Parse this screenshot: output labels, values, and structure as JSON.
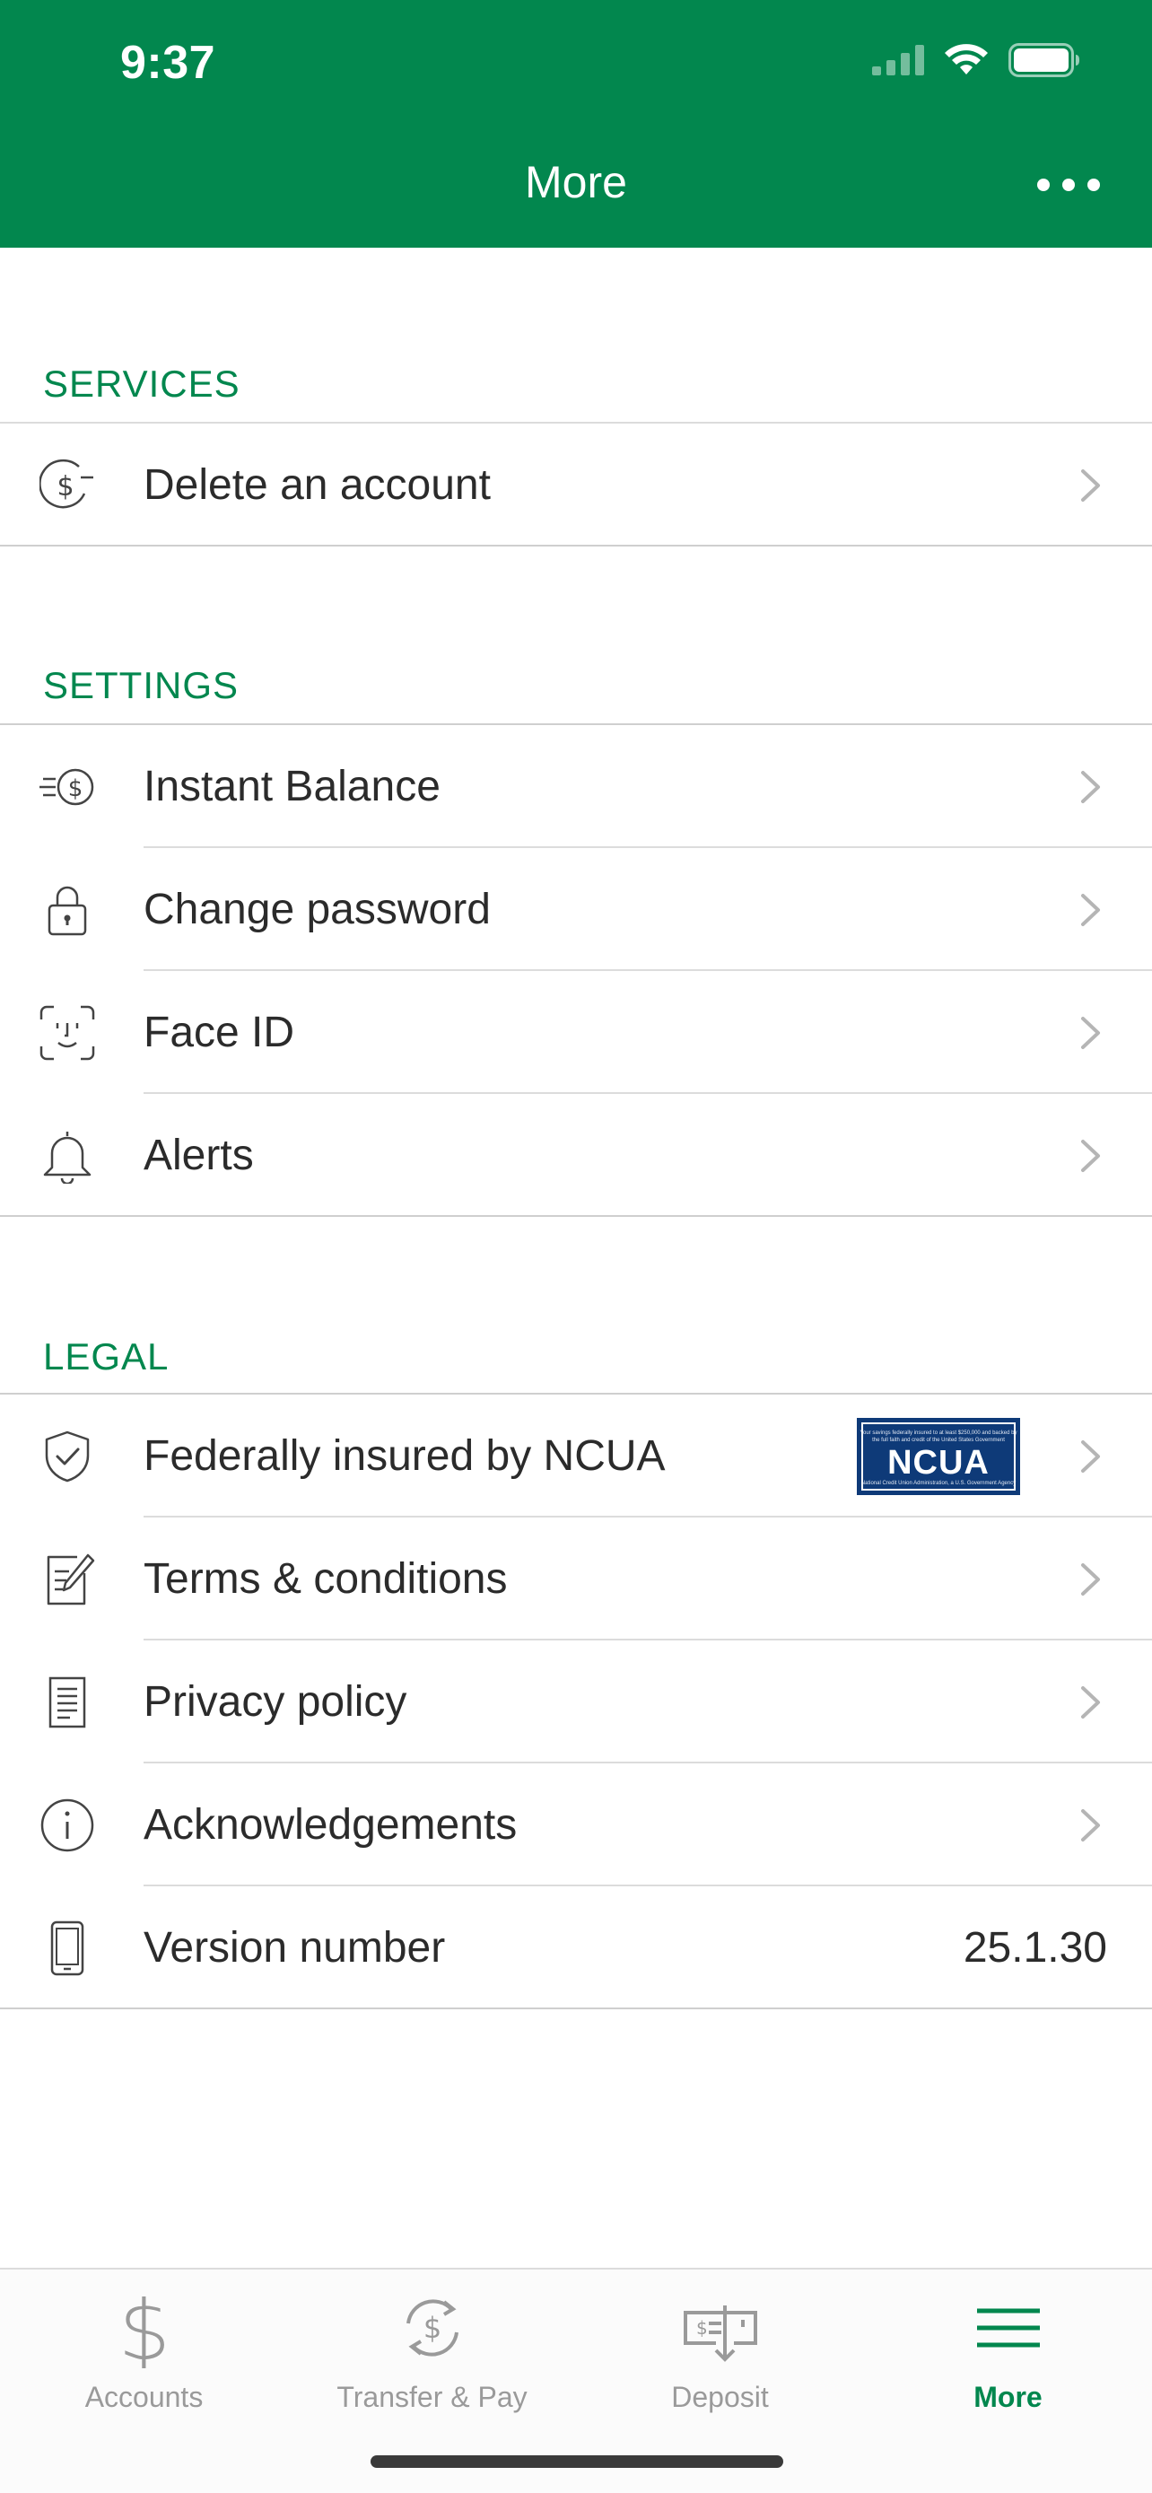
{
  "status_bar": {
    "time": "9:37"
  },
  "header": {
    "title": "More"
  },
  "sections": {
    "services": {
      "title": "SERVICES",
      "items": [
        {
          "label": "Delete an account",
          "icon": "dollar-minus-icon"
        }
      ]
    },
    "settings": {
      "title": "SETTINGS",
      "items": [
        {
          "label": "Instant Balance",
          "icon": "instant-balance-icon"
        },
        {
          "label": "Change password",
          "icon": "lock-icon"
        },
        {
          "label": "Face ID",
          "icon": "face-id-icon"
        },
        {
          "label": "Alerts",
          "icon": "bell-icon"
        }
      ]
    },
    "legal": {
      "title": "LEGAL",
      "items": [
        {
          "label": "Federally insured by NCUA",
          "icon": "shield-check-icon",
          "badge": "NCUA",
          "badge_fine_top": "Your savings federally insured to at least $250,000 and backed by the full faith and credit of the United States Government",
          "badge_fine_bottom": "National Credit Union Administration, a U.S. Government Agency"
        },
        {
          "label": "Terms & conditions",
          "icon": "document-pen-icon"
        },
        {
          "label": "Privacy policy",
          "icon": "document-icon"
        },
        {
          "label": "Acknowledgements",
          "icon": "info-icon"
        },
        {
          "label": "Version number",
          "icon": "phone-icon",
          "value": "25.1.30"
        }
      ]
    }
  },
  "tabbar": {
    "items": [
      {
        "label": "Accounts",
        "icon": "dollar-icon",
        "active": false
      },
      {
        "label": "Transfer & Pay",
        "icon": "transfer-icon",
        "active": false
      },
      {
        "label": "Deposit",
        "icon": "check-deposit-icon",
        "active": false
      },
      {
        "label": "More",
        "icon": "menu-icon",
        "active": true
      }
    ]
  },
  "colors": {
    "brand": "#02874e",
    "ncua_badge": "#0e3a78"
  }
}
